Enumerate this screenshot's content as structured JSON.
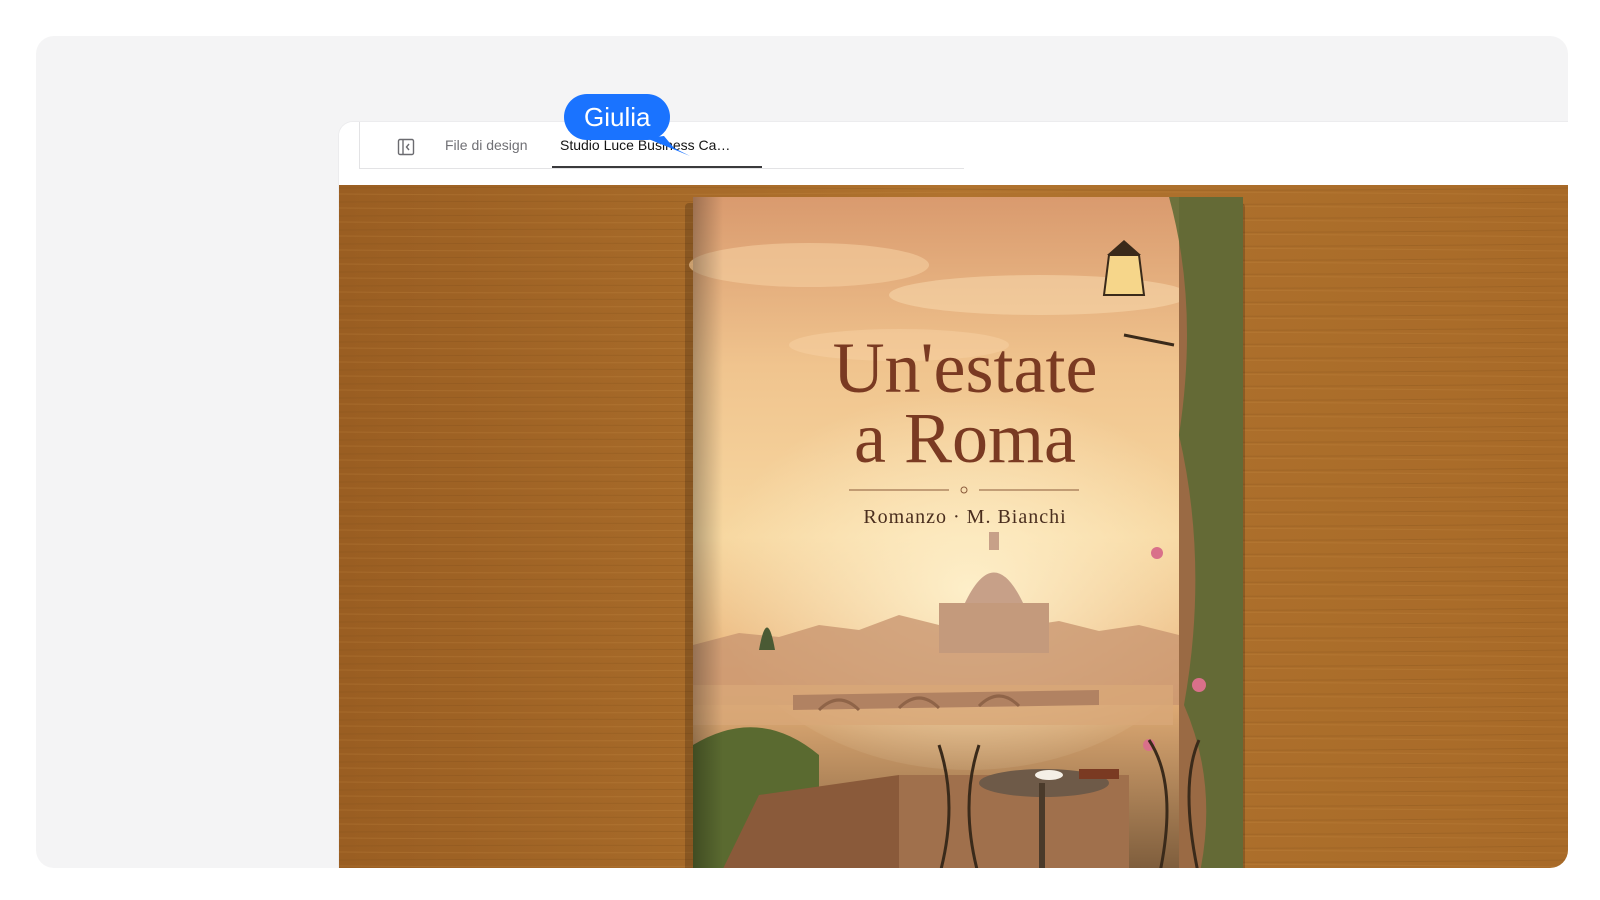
{
  "tabbar": {
    "tabs": [
      {
        "label": "File di design",
        "active": false
      },
      {
        "label": "Studio Luce Business Ca…",
        "active": true
      }
    ]
  },
  "collaborator": {
    "name": "Giulia",
    "color": "#1a73ff"
  },
  "image": {
    "book_title_line1": "Un'estate",
    "book_title_line2": "a Roma",
    "book_subtitle": "Romanzo · M. Bianchi"
  },
  "colors": {
    "wood": "#a86a28",
    "title_color": "#7a3a22",
    "accent": "#1a73ff"
  }
}
